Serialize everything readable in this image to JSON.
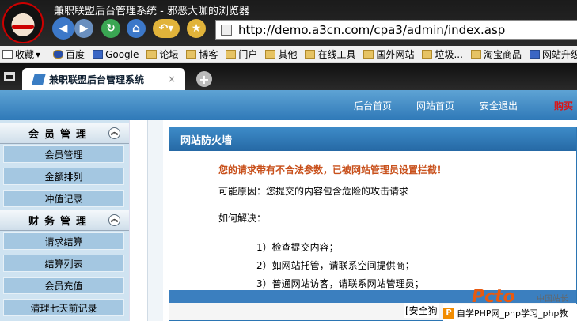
{
  "browser": {
    "window_title": "兼职联盟后台管理系统 - 邪恶大咖的浏览器",
    "url": "http://demo.a3cn.com/cpa3/admin/index.asp"
  },
  "bookmarks": [
    "收藏",
    "百度",
    "Google",
    "论坛",
    "博客",
    "门户",
    "其他",
    "在线工具",
    "国外网站",
    "垃圾...",
    "淘宝商品",
    "网站升级"
  ],
  "tab": {
    "title": "兼职联盟后台管理系统",
    "close": "×",
    "new": "+"
  },
  "header": {
    "links": [
      "后台首页",
      "网站首页",
      "安全退出"
    ],
    "buy": "购买"
  },
  "sidebar": {
    "sections": [
      {
        "title": "会员管理",
        "items": [
          "会员管理",
          "金额排列",
          "冲值记录"
        ]
      },
      {
        "title": "财务管理",
        "items": [
          "请求结算",
          "结算列表",
          "会员充值",
          "清理七天前记录"
        ]
      }
    ]
  },
  "panel": {
    "title": "网站防火墙",
    "warning": "您的请求带有不合法参数，已被网站管理员设置拦截！",
    "reason": "可能原因：您提交的内容包含危险的攻击请求",
    "how_label": "如何解决：",
    "steps": [
      "1）检查提交内容；",
      "2）如网站托管，请联系空间提供商；",
      "3）普通网站访客，请联系网站管理员；"
    ]
  },
  "overlay": {
    "safe_link": "[安全狗",
    "logo": "Pcto",
    "logo_sub": "中国站长",
    "badge": "自学PHP网_php学习_php教"
  },
  "colors": {
    "header_blue": "#2f79b8",
    "warning_orange": "#c8501b",
    "buy_red": "#e01010"
  }
}
